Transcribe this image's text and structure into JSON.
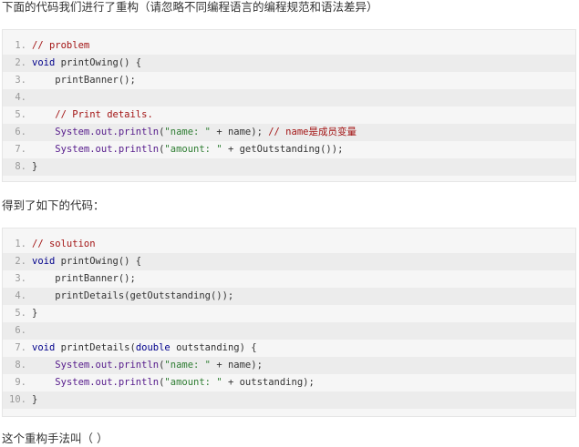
{
  "question": {
    "title": "下面的代码我们进行了重构（请忽略不同编程语言的编程规范和语法差异）",
    "middle": "得到了如下的代码：",
    "bottom": "这个重构手法叫（ ）"
  },
  "code_before": [
    {
      "n": "1.",
      "tokens": [
        {
          "t": "comment",
          "v": "// problem"
        }
      ]
    },
    {
      "n": "2.",
      "tokens": [
        {
          "t": "kw",
          "v": "void"
        },
        {
          "t": "plain",
          "v": " printOwing() {"
        }
      ]
    },
    {
      "n": "3.",
      "tokens": [
        {
          "t": "plain",
          "v": "    printBanner();"
        }
      ]
    },
    {
      "n": "4.",
      "tokens": []
    },
    {
      "n": "5.",
      "tokens": [
        {
          "t": "plain",
          "v": "    "
        },
        {
          "t": "comment",
          "v": "// Print details."
        }
      ]
    },
    {
      "n": "6.",
      "tokens": [
        {
          "t": "plain",
          "v": "    "
        },
        {
          "t": "sys",
          "v": "System.out.println"
        },
        {
          "t": "plain",
          "v": "("
        },
        {
          "t": "str",
          "v": "\"name: \""
        },
        {
          "t": "plain",
          "v": " + name); "
        },
        {
          "t": "comment",
          "v": "// name是成员变量"
        }
      ]
    },
    {
      "n": "7.",
      "tokens": [
        {
          "t": "plain",
          "v": "    "
        },
        {
          "t": "sys",
          "v": "System.out.println"
        },
        {
          "t": "plain",
          "v": "("
        },
        {
          "t": "str",
          "v": "\"amount: \""
        },
        {
          "t": "plain",
          "v": " + getOutstanding());"
        }
      ]
    },
    {
      "n": "8.",
      "tokens": [
        {
          "t": "plain",
          "v": "}"
        }
      ]
    }
  ],
  "code_after": [
    {
      "n": "1.",
      "tokens": [
        {
          "t": "comment",
          "v": "// solution"
        }
      ]
    },
    {
      "n": "2.",
      "tokens": [
        {
          "t": "kw",
          "v": "void"
        },
        {
          "t": "plain",
          "v": " printOwing() {"
        }
      ]
    },
    {
      "n": "3.",
      "tokens": [
        {
          "t": "plain",
          "v": "    printBanner();"
        }
      ]
    },
    {
      "n": "4.",
      "tokens": [
        {
          "t": "plain",
          "v": "    printDetails(getOutstanding());"
        }
      ]
    },
    {
      "n": "5.",
      "tokens": [
        {
          "t": "plain",
          "v": "}"
        }
      ]
    },
    {
      "n": "6.",
      "tokens": []
    },
    {
      "n": "7.",
      "tokens": [
        {
          "t": "kw",
          "v": "void"
        },
        {
          "t": "plain",
          "v": " printDetails("
        },
        {
          "t": "kw",
          "v": "double"
        },
        {
          "t": "plain",
          "v": " outstanding) {"
        }
      ]
    },
    {
      "n": "8.",
      "tokens": [
        {
          "t": "plain",
          "v": "    "
        },
        {
          "t": "sys",
          "v": "System.out.println"
        },
        {
          "t": "plain",
          "v": "("
        },
        {
          "t": "str",
          "v": "\"name: \""
        },
        {
          "t": "plain",
          "v": " + name);"
        }
      ]
    },
    {
      "n": "9.",
      "tokens": [
        {
          "t": "plain",
          "v": "    "
        },
        {
          "t": "sys",
          "v": "System.out.println"
        },
        {
          "t": "plain",
          "v": "("
        },
        {
          "t": "str",
          "v": "\"amount: \""
        },
        {
          "t": "plain",
          "v": " + outstanding);"
        }
      ]
    },
    {
      "n": "10.",
      "tokens": [
        {
          "t": "plain",
          "v": "}"
        }
      ]
    }
  ]
}
